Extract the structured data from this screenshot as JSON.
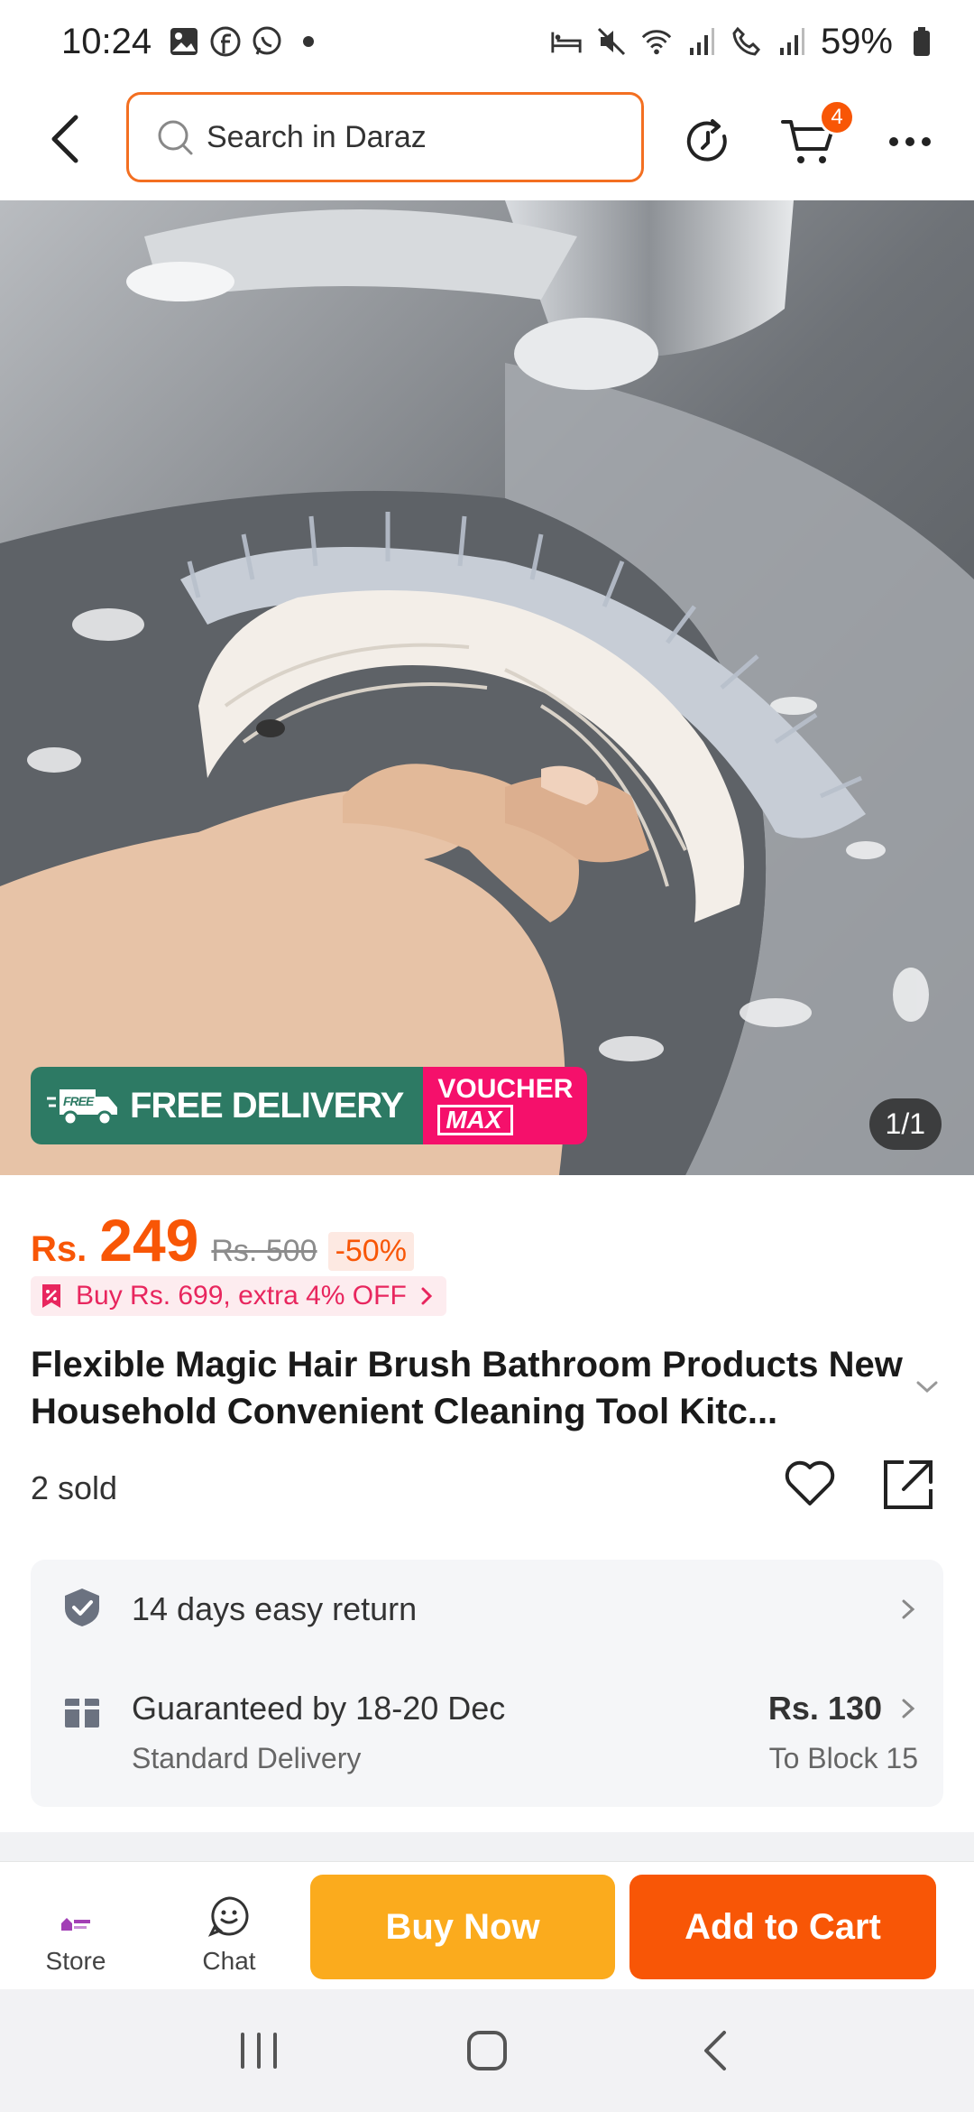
{
  "status_bar": {
    "time": "10:24",
    "battery": "59%"
  },
  "header": {
    "search_placeholder": "Search in Daraz",
    "cart_count": "4"
  },
  "gallery": {
    "banner_free": "FREE DELIVERY",
    "banner_free_tag": "FREE",
    "banner_voucher_top": "VOUCHER",
    "banner_voucher_bottom": "MAX",
    "counter": "1/1"
  },
  "product": {
    "currency": "Rs.",
    "price": "249",
    "old_price": "Rs. 500",
    "discount": "-50%",
    "promo": "Buy Rs. 699, extra 4% OFF",
    "title": "Flexible Magic Hair Brush Bathroom Products New Household Convenient Cleaning Tool Kitc...",
    "sold": "2 sold"
  },
  "services": {
    "return": "14 days easy return",
    "delivery_main": "Guaranteed by 18-20 Dec",
    "delivery_sub": "Standard Delivery",
    "delivery_price": "Rs. 130",
    "delivery_to": "To Block 15"
  },
  "bottom_bar": {
    "store_label": "Store",
    "chat_label": "Chat",
    "buy_now": "Buy Now",
    "add_to_cart": "Add to Cart"
  },
  "colors": {
    "brand_orange": "#f85606",
    "buy_yellow": "#fbab1d",
    "delivery_green": "#2d7a64",
    "voucher_pink": "#f5106b"
  }
}
